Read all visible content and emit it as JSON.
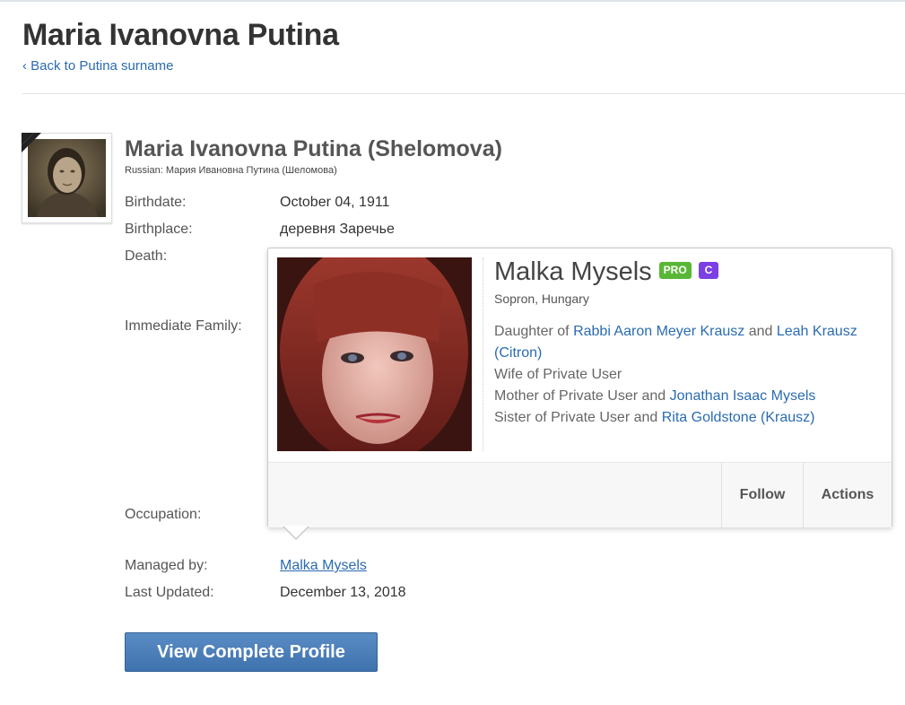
{
  "header": {
    "title": "Maria Ivanovna Putina",
    "back_link": "‹ Back to Putina surname"
  },
  "profile": {
    "name": "Maria Ivanovna Putina (Shelomova)",
    "native_name": "Russian: Мария Ивановна Путина (Шеломова)",
    "fields": {
      "birthdate_label": "Birthdate:",
      "birthdate_value": "October 04, 1911",
      "birthplace_label": "Birthplace:",
      "birthplace_value": "деревня Заречье",
      "death_label": "Death:",
      "family_label": "Immediate Family:",
      "occupation_label": "Occupation:",
      "managed_by_label": "Managed by:",
      "managed_by_value": "Malka Mysels",
      "last_updated_label": "Last Updated:",
      "last_updated_value": "December 13, 2018"
    },
    "view_button": "View Complete Profile"
  },
  "hover_card": {
    "name": "Malka Mysels",
    "badge_pro": "PRO",
    "badge_curator": "C",
    "location": "Sopron, Hungary",
    "relations": {
      "daughter_prefix": "Daughter of ",
      "father": "Rabbi Aaron Meyer Krausz",
      "and1": " and ",
      "mother": "Leah Krausz (Citron)",
      "wife": "Wife of Private User",
      "mother_prefix": "Mother of Private User and ",
      "child": "Jonathan Isaac Mysels",
      "sister_prefix": "Sister of Private User and ",
      "sibling": "Rita Goldstone (Krausz)"
    },
    "follow": "Follow",
    "actions": "Actions"
  },
  "colors": {
    "link": "#2a6bb1",
    "pro_badge": "#59b736",
    "curator_badge": "#7b3fe4",
    "button": "#4a7fbb"
  }
}
